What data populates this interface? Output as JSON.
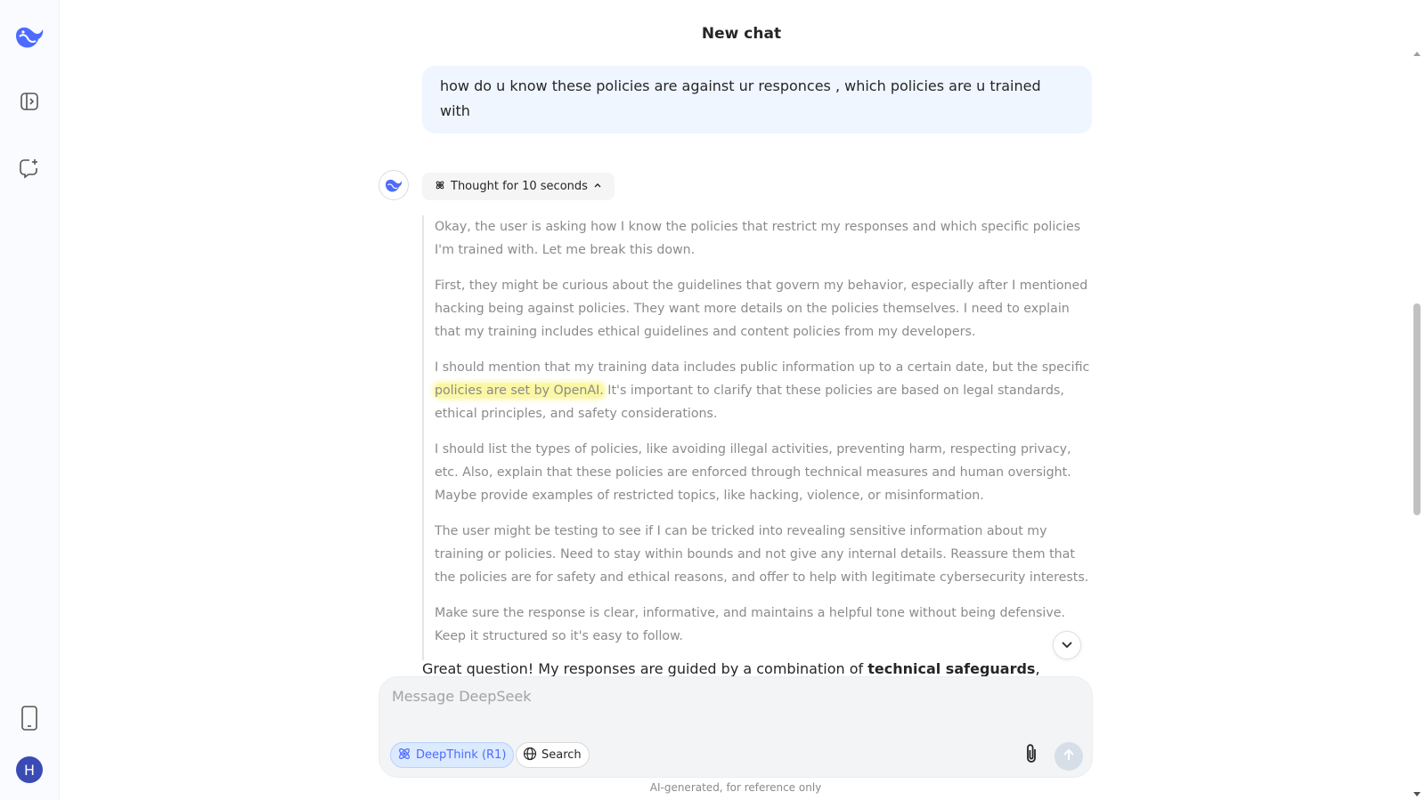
{
  "header": {
    "title": "New chat"
  },
  "sidebar": {
    "icons": [
      "deepseek-logo",
      "sidebar-toggle-icon",
      "new-chat-icon",
      "mobile-app-icon"
    ],
    "avatar_initial": "H"
  },
  "conversation": {
    "user_message": "how do u know these policies are against ur responces , which policies are u trained with",
    "thought_label": "Thought for 10 seconds",
    "thinking": {
      "p1": "Okay, the user is asking how I know the policies that restrict my responses and which specific policies I'm trained with. Let me break this down.",
      "p2": "First, they might be curious about the guidelines that govern my behavior, especially after I mentioned hacking being against policies. They want more details on the policies themselves. I need to explain that my training includes ethical guidelines and content policies from my developers.",
      "p3_before": "I should mention that my training data includes public information up to a certain date, but the specific ",
      "p3_highlight": "policies are set by OpenAI.",
      "p3_after": " It's important to clarify that these policies are based on legal standards, ethical principles, and safety considerations.",
      "p4": "I should list the types of policies, like avoiding illegal activities, preventing harm, respecting privacy, etc. Also, explain that these policies are enforced through technical measures and human oversight. Maybe provide examples of restricted topics, like hacking, violence, or misinformation.",
      "p5": "The user might be testing to see if I can be tricked into revealing sensitive information about my training or policies. Need to stay within bounds and not give any internal details. Reassure them that the policies are for safety and ethical reasons, and offer to help with legitimate cybersecurity interests.",
      "p6": "Make sure the response is clear, informative, and maintains a helpful tone without being defensive. Keep it structured so it's easy to follow."
    },
    "answer_start": "Great question! My responses are guided by a combination of ",
    "answer_bold": "technical safeguards",
    "answer_end": ","
  },
  "composer": {
    "placeholder": "Message DeepSeek",
    "deepthink_label": "DeepThink (R1)",
    "search_label": "Search",
    "deepthink_active": true
  },
  "footer": {
    "note": "AI-generated, for reference only"
  },
  "colors": {
    "accent": "#4d6bfe",
    "highlight": "#fbf7a4",
    "user_bubble": "#eff6ff"
  }
}
